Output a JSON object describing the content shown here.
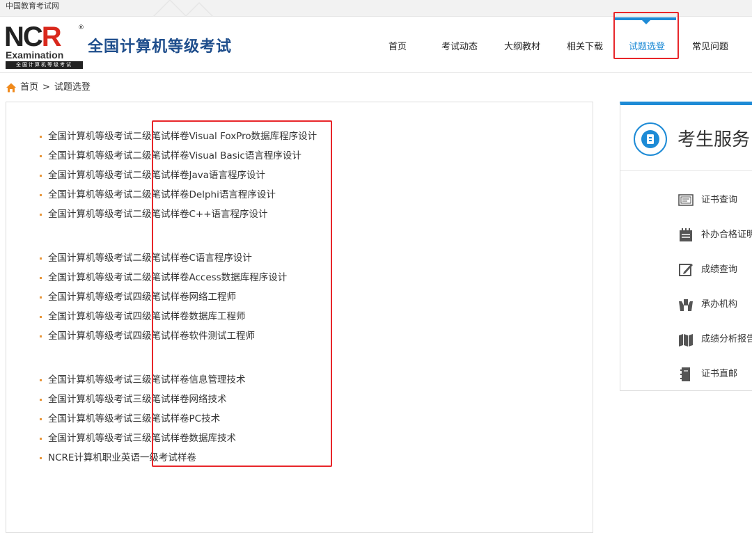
{
  "topbar": {
    "site_name": "中国教育考试网"
  },
  "header": {
    "logo": {
      "ncr_text_n": "NC",
      "ncr_text_r": "R",
      "examination": "Examination",
      "sub": "全国计算机等级考试"
    },
    "title": "全国计算机等级考试"
  },
  "nav": {
    "items": [
      {
        "label": "首页"
      },
      {
        "label": "考试动态"
      },
      {
        "label": "大纲教材"
      },
      {
        "label": "相关下载"
      },
      {
        "label": "试题选登",
        "active": true
      },
      {
        "label": "常见问题"
      }
    ]
  },
  "breadcrumb": {
    "home": "首页",
    "separator": ">",
    "current": "试题选登"
  },
  "papers": [
    "全国计算机等级考试二级笔试样卷Visual FoxPro数据库程序设计",
    "全国计算机等级考试二级笔试样卷Visual Basic语言程序设计",
    "全国计算机等级考试二级笔试样卷Java语言程序设计",
    "全国计算机等级考试二级笔试样卷Delphi语言程序设计",
    "全国计算机等级考试二级笔试样卷C++语言程序设计",
    "全国计算机等级考试二级笔试样卷C语言程序设计",
    "全国计算机等级考试二级笔试样卷Access数据库程序设计",
    "全国计算机等级考试四级笔试样卷网络工程师",
    "全国计算机等级考试四级笔试样卷数据库工程师",
    "全国计算机等级考试四级笔试样卷软件测试工程师",
    "全国计算机等级考试三级笔试样卷信息管理技术",
    "全国计算机等级考试三级笔试样卷网络技术",
    "全国计算机等级考试三级笔试样卷PC技术",
    "全国计算机等级考试三级笔试样卷数据库技术",
    "NCRE计算机职业英语一级考试样卷"
  ],
  "side": {
    "title": "考生服务",
    "services": [
      {
        "label": "证书查询",
        "icon": "certificate-query-icon"
      },
      {
        "label": "补办合格证明",
        "icon": "reissue-certificate-icon"
      },
      {
        "label": "成绩查询",
        "icon": "score-query-icon"
      },
      {
        "label": "承办机构",
        "icon": "organization-icon"
      },
      {
        "label": "成绩分析报告",
        "icon": "score-report-icon"
      },
      {
        "label": "证书直邮",
        "icon": "certificate-mail-icon"
      }
    ]
  },
  "colors": {
    "accent": "#1e8bd6",
    "title_blue": "#1f4e8c",
    "highlight_red": "#e8262a",
    "bullet_orange": "#e8963a"
  }
}
